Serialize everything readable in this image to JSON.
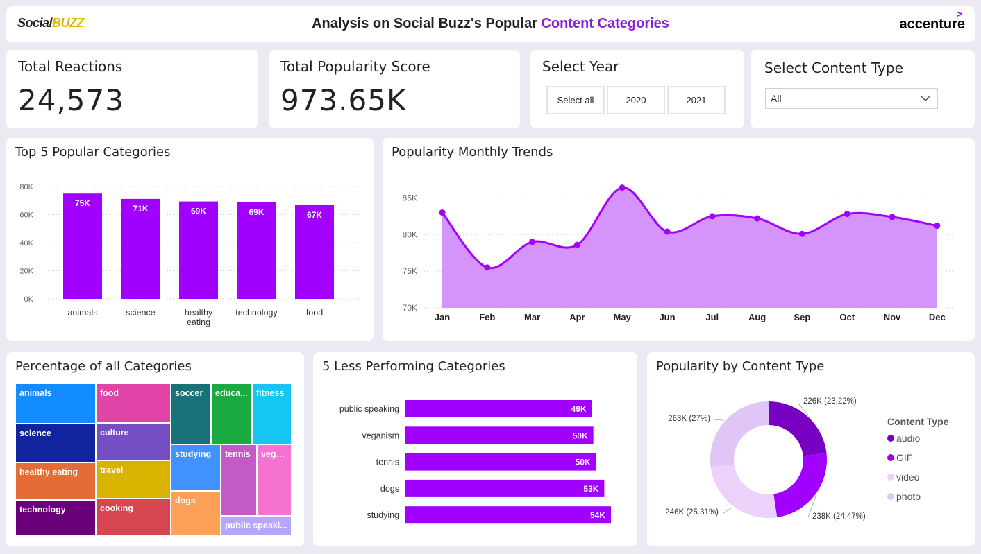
{
  "header": {
    "logo_left_a": "Social",
    "logo_left_b": "BUZZ",
    "title_a": "Analysis on Social Buzz's Popular ",
    "title_b": "Content Categories",
    "logo_right": "accenture",
    "logo_right_mark": ">"
  },
  "kpis": [
    {
      "label": "Total Reactions",
      "value": "24,573"
    },
    {
      "label": "Total Popularity Score",
      "value": "973.65K"
    }
  ],
  "year_filter": {
    "label": "Select Year",
    "options": [
      "Select all",
      "2020",
      "2021"
    ]
  },
  "type_filter": {
    "label": "Select Content Type",
    "selected": "All"
  },
  "colors": {
    "accent": "#a100ff",
    "area": "#d494fb",
    "line": "#a100ff"
  },
  "top5": {
    "title": "Top 5 Popular Categories",
    "chart_data": {
      "type": "bar",
      "categories": [
        "animals",
        "science",
        "healthy eating",
        "technology",
        "food"
      ],
      "values": [
        74965,
        71168,
        69339,
        68738,
        66676
      ],
      "data_labels": [
        "75K",
        "71K",
        "69K",
        "69K",
        "67K"
      ],
      "yticks": [
        "0K",
        "20K",
        "40K",
        "60K",
        "80K"
      ],
      "ylim": [
        0,
        80000
      ]
    }
  },
  "trend": {
    "title": "Popularity Monthly Trends",
    "chart_data": {
      "type": "area",
      "x": [
        "Jan",
        "Feb",
        "Mar",
        "Apr",
        "May",
        "Jun",
        "Jul",
        "Aug",
        "Sep",
        "Oct",
        "Nov",
        "Dec"
      ],
      "values": [
        83000,
        75500,
        79000,
        78600,
        86400,
        80400,
        82500,
        82200,
        80100,
        82800,
        82400,
        81200
      ],
      "yticks": [
        "70K",
        "75K",
        "80K",
        "85K"
      ],
      "ylim": [
        70000,
        87500
      ]
    }
  },
  "pct": {
    "title": "Percentage of all Categories",
    "tiles": [
      {
        "label": "animals",
        "color": "#118dff"
      },
      {
        "label": "science",
        "color": "#12239e"
      },
      {
        "label": "healthy eating",
        "color": "#e66c37"
      },
      {
        "label": "technology",
        "color": "#6b007b"
      },
      {
        "label": "food",
        "color": "#e044a7"
      },
      {
        "label": "culture",
        "color": "#744ec2"
      },
      {
        "label": "travel",
        "color": "#d9b300"
      },
      {
        "label": "cooking",
        "color": "#d64550"
      },
      {
        "label": "soccer",
        "color": "#197278"
      },
      {
        "label": "educa...",
        "color": "#1aab40"
      },
      {
        "label": "fitness",
        "color": "#15c6f4"
      },
      {
        "label": "studying",
        "color": "#4092ff"
      },
      {
        "label": "tennis",
        "color": "#c35bc7"
      },
      {
        "label": "vega...",
        "color": "#f472d0"
      },
      {
        "label": "dogs",
        "color": "#ffa058"
      },
      {
        "label": "public speaki...",
        "color": "#b6a6ff"
      }
    ]
  },
  "less5": {
    "title": "5 Less Performing Categories",
    "chart_data": {
      "type": "bar",
      "orientation": "horizontal",
      "categories": [
        "public speaking",
        "veganism",
        "tennis",
        "dogs",
        "studying"
      ],
      "values": [
        49264,
        49619,
        50339,
        52511,
        54269
      ],
      "data_labels": [
        "49K",
        "50K",
        "50K",
        "53K",
        "54K"
      ]
    }
  },
  "ctype": {
    "title": "Popularity by Content Type",
    "legend_title": "Content Type",
    "chart_data": {
      "type": "pie",
      "labels": [
        "audio",
        "GIF",
        "video",
        "photo"
      ],
      "values": [
        226000,
        238000,
        246000,
        263000
      ],
      "data_labels": [
        "226K (23.22%)",
        "238K (24.47%)",
        "246K (25.31%)",
        "263K (27%)"
      ],
      "colors": [
        "#7800c2",
        "#a100ff",
        "#ead2fb",
        "#e0c6f7"
      ]
    }
  }
}
